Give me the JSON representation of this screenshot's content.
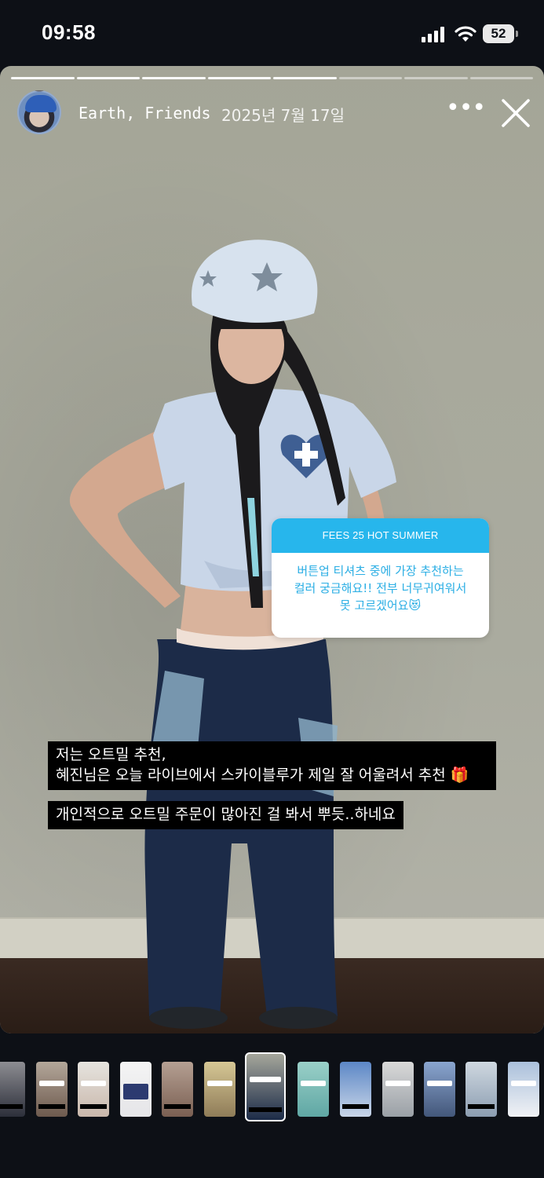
{
  "status_bar": {
    "time": "09:58",
    "battery": "52"
  },
  "story": {
    "user": "Earth, Friends",
    "date": "2025년 7월 17일",
    "progress_total": 8,
    "progress_current": 5
  },
  "question": {
    "title": "FEES 25 HOT SUMMER",
    "line1": "버튼업 티셔츠 중에 가장 추천하는",
    "line2": "컬러 궁금해요!! 전부 너무귀여워서",
    "line3": "못 고르겠어요😻"
  },
  "captions": {
    "line1": "저는 오트밀 추천,",
    "line2": "혜진님은 오늘 라이브에서 스카이블루가 제일 잘 어울려서 추천 🎁",
    "line3": "개인적으로 오트밀 주문이 많아진 걸 봐서 뿌듯..하네요"
  },
  "colors": {
    "accent": "#27b6ec",
    "shirt": "#c9d6e8",
    "jeans": "#1c2b48"
  }
}
